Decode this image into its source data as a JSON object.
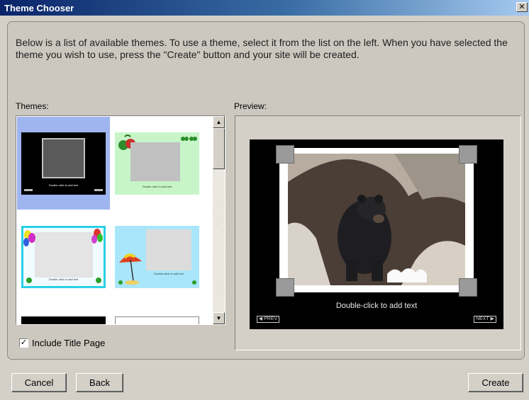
{
  "window": {
    "title": "Theme Chooser",
    "close_glyph": "✕"
  },
  "instructions": "Below is a list of available themes. To use a theme, select it from the list on the left. When you have selected the theme you wish to use, press the \"Create\" button and your site will be created.",
  "themes_panel": {
    "label": "Themes:",
    "items": [
      {
        "caption": "Double-click to add text",
        "background": "#000000",
        "selected": true
      },
      {
        "caption": "Double-click to add text",
        "background": "#c7f5c8",
        "selected": false
      },
      {
        "caption": "Double-click to add text",
        "background": "#f0fcff",
        "selected": false
      },
      {
        "caption": "Double-click to add text",
        "background": "#a9e6fb",
        "selected": false
      }
    ],
    "scroll_up_glyph": "▲",
    "scroll_down_glyph": "▼"
  },
  "include_title_page": {
    "label": "Include Title Page",
    "checked": true,
    "check_glyph": "✓"
  },
  "preview_panel": {
    "label": "Preview:",
    "caption": "Double-click to add text",
    "prev_label": "◀ PREV",
    "next_label": "NEXT ▶"
  },
  "buttons": {
    "cancel": "Cancel",
    "back": "Back",
    "create": "Create"
  },
  "colors": {
    "titlebar_start": "#0a246a",
    "selection": "#9fb5f0",
    "dialog_bg": "#d4d0c8"
  }
}
